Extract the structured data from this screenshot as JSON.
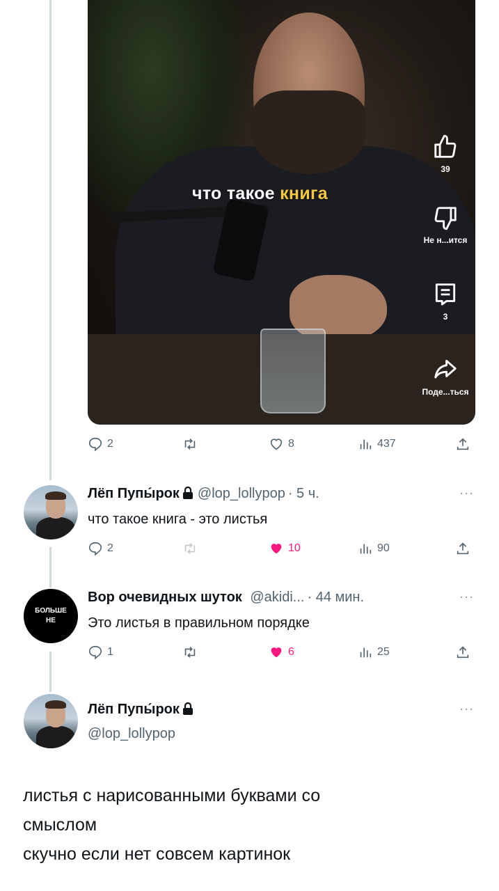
{
  "video": {
    "caption_plain": "что такое ",
    "caption_highlight": "книга",
    "like_count": "39",
    "dislike_label": "Не н...ится",
    "comment_count": "3",
    "share_label": "Поде...ться",
    "icons": [
      "thumb-up-icon",
      "thumb-down-icon",
      "comment-icon",
      "share-arrow-icon"
    ]
  },
  "original_actions": {
    "replies": "2",
    "retweets": "",
    "likes": "8",
    "views": "437"
  },
  "replies": [
    {
      "name": "Лёп Пупы́рок",
      "handle": "@lop_lollypop",
      "time": "· 5 ч.",
      "text": "что такое книга - это листья",
      "actions": {
        "replies": "2",
        "likes": "10",
        "views": "90",
        "liked": true
      }
    },
    {
      "name": "Вор очевидных шуток",
      "handle": "@akidi...",
      "time": "· 44 мин.",
      "avatar_line1": "БОЛЬШЕ",
      "avatar_line2": "НЕ",
      "text": "Это листья в правильном порядке",
      "actions": {
        "replies": "1",
        "likes": "6",
        "views": "25",
        "liked": true
      }
    }
  ],
  "main_tweet": {
    "name": "Лёп Пупы́рок",
    "handle": "@lop_lollypop",
    "line1": "листья с нарисованными буквами со",
    "line2": "смыслом",
    "line3": "скучно если нет совсем картинок"
  },
  "more_label": "···",
  "colors": {
    "like": "#f91880",
    "meta": "#536471",
    "thread_line": "#cfd9de",
    "caption_highlight": "#f5c842"
  }
}
